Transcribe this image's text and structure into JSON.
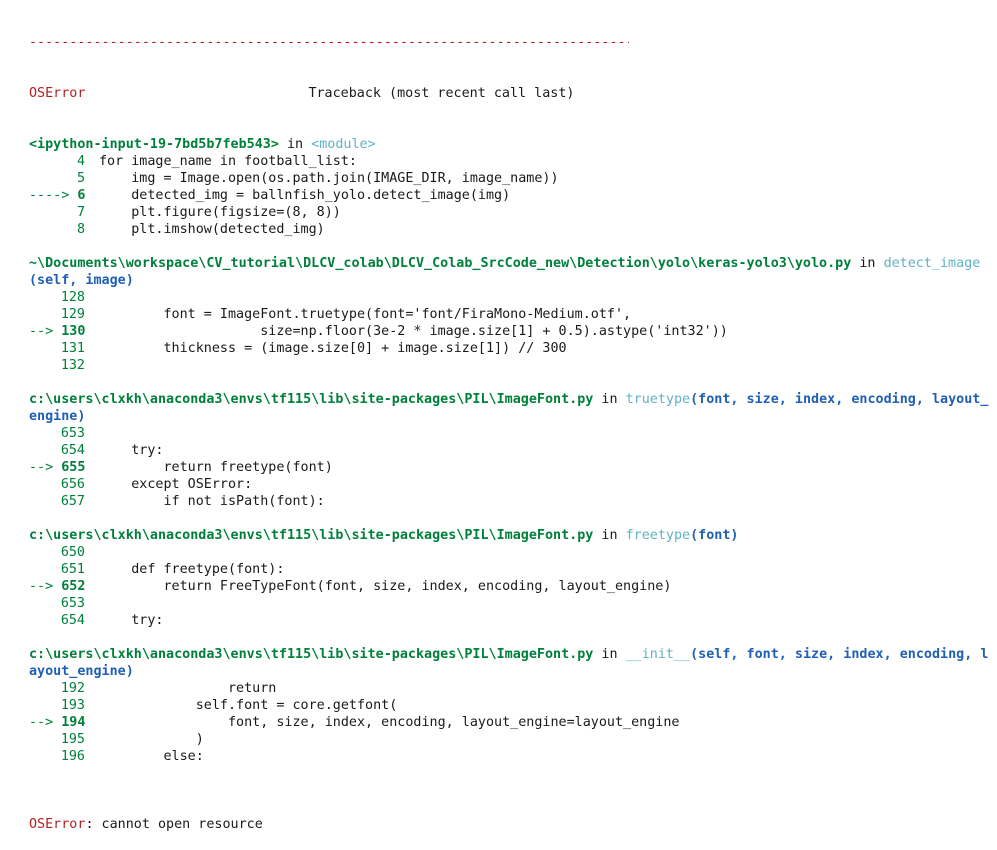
{
  "separator": "--------------------------------------------------------------------------------------------",
  "header": {
    "error_name": "OSError",
    "traceback_label": "Traceback (most recent call last)"
  },
  "frames": [
    {
      "location": "<ipython-input-19-7bd5b7feb543>",
      "in_word": " in ",
      "func": "<module>",
      "args": "",
      "lines": [
        {
          "marker": "",
          "num": "4",
          "code": "for image_name in football_list:"
        },
        {
          "marker": "",
          "num": "5",
          "code": "    img = Image.open(os.path.join(IMAGE_DIR, image_name))"
        },
        {
          "marker": "----> ",
          "num": "6",
          "code": "    detected_img = ballnfish_yolo.detect_image(img)"
        },
        {
          "marker": "",
          "num": "7",
          "code": "    plt.figure(figsize=(8, 8))"
        },
        {
          "marker": "",
          "num": "8",
          "code": "    plt.imshow(detected_img)"
        }
      ]
    },
    {
      "location": "~\\Documents\\workspace\\CV_tutorial\\DLCV_colab\\DLCV_Colab_SrcCode_new\\Detection\\yolo\\keras-yolo3\\yolo.py",
      "in_word": " in ",
      "func": "detect_image",
      "args": "(self, image)",
      "lines": [
        {
          "marker": "",
          "num": "128",
          "code": ""
        },
        {
          "marker": "",
          "num": "129",
          "code": "        font = ImageFont.truetype(font='font/FiraMono-Medium.otf',"
        },
        {
          "marker": "--> ",
          "num": "130",
          "code": "                    size=np.floor(3e-2 * image.size[1] + 0.5).astype('int32'))"
        },
        {
          "marker": "",
          "num": "131",
          "code": "        thickness = (image.size[0] + image.size[1]) // 300"
        },
        {
          "marker": "",
          "num": "132",
          "code": ""
        }
      ]
    },
    {
      "location": "c:\\users\\clxkh\\anaconda3\\envs\\tf115\\lib\\site-packages\\PIL\\ImageFont.py",
      "in_word": " in ",
      "func": "truetype",
      "args": "(font, size, index, encoding, layout_engine)",
      "lines": [
        {
          "marker": "",
          "num": "653",
          "code": ""
        },
        {
          "marker": "",
          "num": "654",
          "code": "    try:"
        },
        {
          "marker": "--> ",
          "num": "655",
          "code": "        return freetype(font)"
        },
        {
          "marker": "",
          "num": "656",
          "code": "    except OSError:"
        },
        {
          "marker": "",
          "num": "657",
          "code": "        if not isPath(font):"
        }
      ]
    },
    {
      "location": "c:\\users\\clxkh\\anaconda3\\envs\\tf115\\lib\\site-packages\\PIL\\ImageFont.py",
      "in_word": " in ",
      "func": "freetype",
      "args": "(font)",
      "lines": [
        {
          "marker": "",
          "num": "650",
          "code": ""
        },
        {
          "marker": "",
          "num": "651",
          "code": "    def freetype(font):"
        },
        {
          "marker": "--> ",
          "num": "652",
          "code": "        return FreeTypeFont(font, size, index, encoding, layout_engine)"
        },
        {
          "marker": "",
          "num": "653",
          "code": ""
        },
        {
          "marker": "",
          "num": "654",
          "code": "    try:"
        }
      ]
    },
    {
      "location": "c:\\users\\clxkh\\anaconda3\\envs\\tf115\\lib\\site-packages\\PIL\\ImageFont.py",
      "in_word": " in ",
      "func": "__init__",
      "args": "(self, font, size, index, encoding, layout_engine)",
      "lines": [
        {
          "marker": "",
          "num": "192",
          "code": "                return"
        },
        {
          "marker": "",
          "num": "193",
          "code": "            self.font = core.getfont("
        },
        {
          "marker": "--> ",
          "num": "194",
          "code": "                font, size, index, encoding, layout_engine=layout_engine"
        },
        {
          "marker": "",
          "num": "195",
          "code": "            )"
        },
        {
          "marker": "",
          "num": "196",
          "code": "        else:"
        }
      ]
    }
  ],
  "final_error": {
    "name": "OSError",
    "message": ": cannot open resource"
  },
  "colors": {
    "error": "#b22222",
    "line_number": "#00803a",
    "function_name": "#5fb3c6",
    "args": "#1f5fb4",
    "background": "#ffffff"
  }
}
